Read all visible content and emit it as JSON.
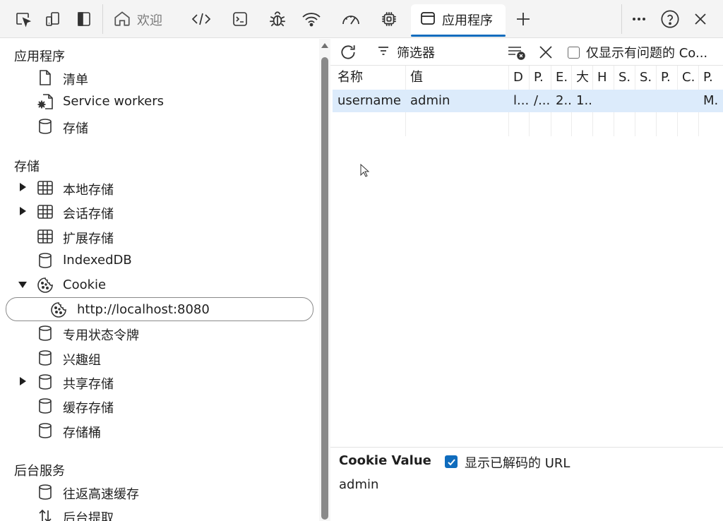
{
  "topbar": {
    "tabs": [
      {
        "label": "欢迎",
        "icon": "home-icon"
      },
      {
        "label": "应用程序",
        "icon": "application-icon"
      }
    ],
    "add_tab": "+",
    "more": "···",
    "help": "?",
    "close": "✕"
  },
  "sidebar": {
    "sections": [
      "应用程序",
      "存储",
      "后台服务"
    ],
    "items": [
      {
        "label": "清单",
        "icon": "document-icon"
      },
      {
        "label": "Service workers",
        "icon": "service-worker-icon"
      },
      {
        "label": "存储",
        "icon": "database-icon"
      },
      {
        "label": "本地存储",
        "icon": "table-icon"
      },
      {
        "label": "会话存储",
        "icon": "table-icon"
      },
      {
        "label": "扩展存储",
        "icon": "table-icon"
      },
      {
        "label": "IndexedDB",
        "icon": "database-icon"
      },
      {
        "label": "Cookie",
        "icon": "cookie-icon"
      },
      {
        "label": "http://localhost:8080",
        "icon": "cookie-icon"
      },
      {
        "label": "专用状态令牌",
        "icon": "database-icon"
      },
      {
        "label": "兴趣组",
        "icon": "database-icon"
      },
      {
        "label": "共享存储",
        "icon": "database-icon"
      },
      {
        "label": "缓存存储",
        "icon": "database-icon"
      },
      {
        "label": "存储桶",
        "icon": "database-icon"
      },
      {
        "label": "往返高速缓存",
        "icon": "database-icon"
      },
      {
        "label": "后台提取",
        "icon": "background-fetch-icon"
      }
    ]
  },
  "toolbar": {
    "filter_label": "筛选器",
    "only_issues_label": "仅显示有问题的 Co..."
  },
  "table": {
    "columns": [
      "名称",
      "值",
      "D",
      "P.",
      "E.",
      "大",
      "H",
      "S.",
      "S.",
      "P.",
      "C.",
      "P."
    ],
    "rows": [
      [
        "username",
        "admin",
        "l...",
        "/...",
        "2...",
        "1...",
        "",
        "",
        "",
        "",
        "",
        "M."
      ]
    ]
  },
  "cookie_value": {
    "title": "Cookie Value",
    "show_decoded_label": "显示已解码的 URL",
    "show_decoded_checked": true,
    "value": "admin"
  },
  "colors": {
    "accent": "#0f6cbd",
    "selected_row": "#dcebfb"
  }
}
